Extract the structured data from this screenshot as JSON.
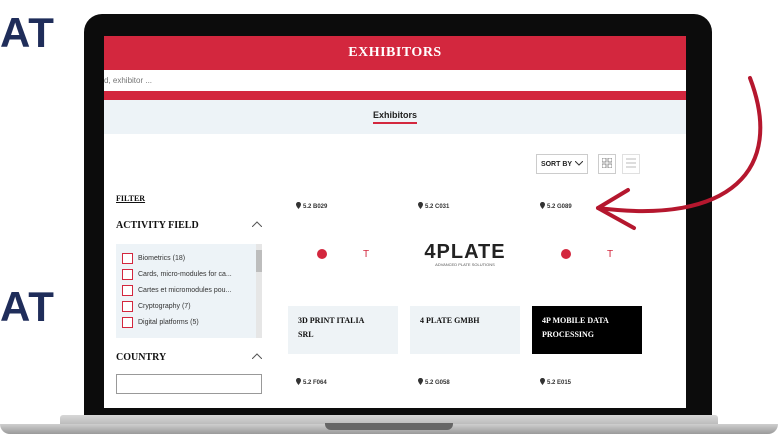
{
  "side_fragments": {
    "top": "AT",
    "bottom": "AT"
  },
  "app": {
    "title": "EXHIBITORS",
    "search_placeholder": "d, exhibitor ...",
    "tab_label": "Exhibitors",
    "sort_label": "SORT BY",
    "filter_label": "FILTER",
    "activity_field_label": "ACTIVITY FIELD",
    "country_label": "COUNTRY"
  },
  "activity_items": [
    "Biometrics  (18)",
    "Cards, micro-modules for ca...",
    "Cartes et micromodules pou...",
    "Cryptography  (7)",
    "Digital platforms  (5)"
  ],
  "exhibitors": [
    {
      "location": "5.2 B029",
      "name_lines": [
        "3D PRINT ITALIA",
        "SRL"
      ],
      "logo": "dot-t-logo"
    },
    {
      "location": "5.2 C031",
      "name_lines": [
        "4 PLATE GMBH"
      ],
      "logo": "4plate-logo",
      "logo_text": "4PLATE",
      "logo_sub": "ADVANCED PLATE SOLUTIONS"
    },
    {
      "location": "5.2 G089",
      "name_lines": [
        "4P MOBILE DATA",
        "PROCESSING"
      ],
      "logo": "dot-t-logo"
    },
    {
      "location": "5.2 F064"
    },
    {
      "location": "5.2 G058"
    },
    {
      "location": "5.2 E015"
    }
  ],
  "colors": {
    "brand_red": "#d3273e",
    "light_panel": "#edf3f7",
    "navy": "#1f2d5a"
  }
}
